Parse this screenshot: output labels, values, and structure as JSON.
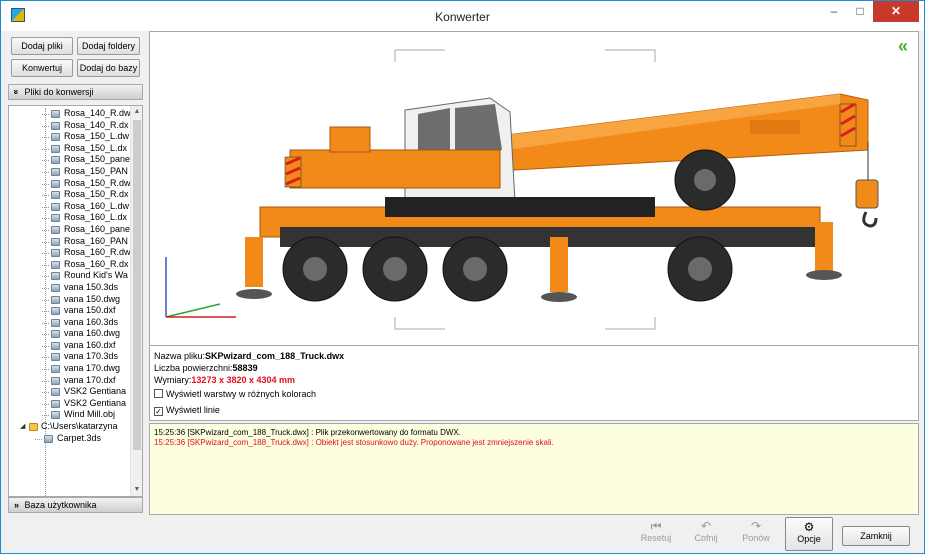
{
  "window": {
    "title": "Konwerter",
    "min_glyph": "–",
    "max_glyph": "□",
    "close_glyph": "✕"
  },
  "toolbar": {
    "add_files": "Dodaj pliki",
    "add_folders": "Dodaj foldery",
    "convert": "Konwertuj",
    "add_to_db": "Dodaj do bazy"
  },
  "files_section": {
    "chevron": "»",
    "label": "Pliki do konwersji"
  },
  "tree": {
    "items": [
      "Rosa_140_R.dw",
      "Rosa_140_R.dx",
      "Rosa_150_L.dw",
      "Rosa_150_L.dx",
      "Rosa_150_pane",
      "Rosa_150_PAN",
      "Rosa_150_R.dw",
      "Rosa_150_R.dx",
      "Rosa_160_L.dw",
      "Rosa_160_L.dx",
      "Rosa_160_pane",
      "Rosa_160_PAN",
      "Rosa_160_R.dw",
      "Rosa_160_R.dx",
      "Round Kid's Wa",
      "vana 150.3ds",
      "vana 150.dwg",
      "vana 150.dxf",
      "vana 160.3ds",
      "vana 160.dwg",
      "vana 160.dxf",
      "vana 170.3ds",
      "vana 170.dwg",
      "vana 170.dxf",
      "VSK2 Gentiana",
      "VSK2 Gentiana",
      "Wind Mill.obj"
    ],
    "folder": {
      "expander": "◢",
      "label": "C:\\Users\\katarzyna"
    },
    "sub_item": "Carpet.3ds"
  },
  "user_db_section": {
    "chevron": "»",
    "label": "Baza użytkownika"
  },
  "viewer": {
    "collapse_glyph": "«"
  },
  "info": {
    "filename_label": "Nazwa pliku:",
    "filename": "SKPwizard_com_188_Truck.dwx",
    "surfaces_label": "Liczba powierzchni:",
    "surfaces": "58839",
    "dims_label": "Wymiary:",
    "dims": "13273 x 3820 x 4304 mm",
    "layers_checkbox": "Wyświetl warstwy w różnych kolorach",
    "layers_checked": false,
    "lines_checkbox": "Wyświetl linie",
    "lines_checked": true,
    "checkmark": "✓"
  },
  "log": [
    {
      "text": "15:25:36 [SKPwizard_com_188_Truck.dwx] : Plik przekonwertowany do formatu DWX.",
      "type": "info"
    },
    {
      "text": "15:25:36 [SKPwizard_com_188_Truck.dwx] : Obiekt jest stosunkowo duży. Proponowane jest zmniejszenie skali.",
      "type": "error"
    }
  ],
  "bottom": {
    "reset": "Resetuj",
    "reset_icon": "⏮",
    "undo": "Cofnij",
    "undo_icon": "↶",
    "redo": "Ponów",
    "redo_icon": "↷",
    "options": "Opcje",
    "options_icon": "⚙",
    "close": "Zamknij"
  },
  "colors": {
    "crane_orange": "#f28a1a",
    "accent_green": "#4caf29",
    "log_error": "#e0101a",
    "log_bg": "#fdfde0"
  }
}
